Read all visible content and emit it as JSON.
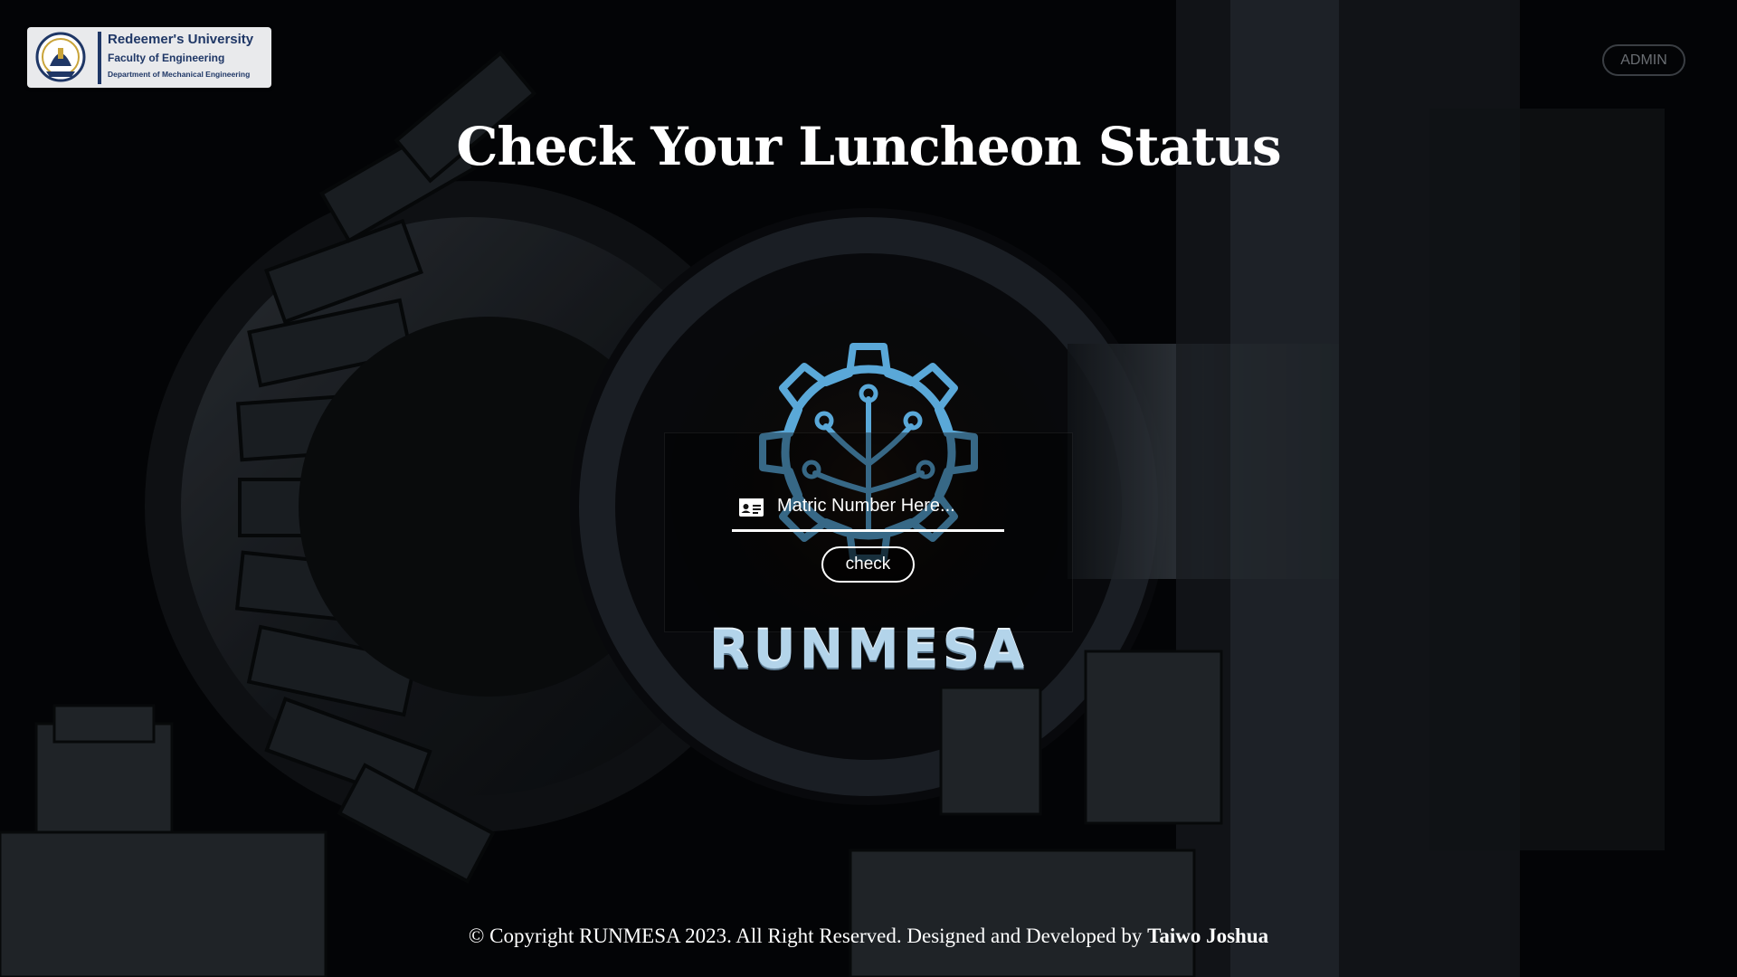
{
  "header": {
    "logo": {
      "university": "Redeemer's University",
      "faculty": "Faculty of Engineering",
      "department": "Department of Mechanical Engineering",
      "seal_icon": "university-seal-icon"
    },
    "admin_label": "ADMIN"
  },
  "main": {
    "title": "Check Your Luncheon Status",
    "form": {
      "input_icon": "id-card-icon",
      "matric_placeholder": "Matric Number Here...",
      "matric_value": "",
      "check_label": "check"
    },
    "brand_logo": {
      "icon": "gear-circuit-icon",
      "wordmark": "RUNMESA",
      "color": "#5aa8d8"
    }
  },
  "footer": {
    "copyright": "© Copyright RUNMESA 2023. All Right Reserved. Designed and Developed by ",
    "author": "Taiwo Joshua"
  },
  "colors": {
    "background": "#050608",
    "accent_blue": "#5aa8d8",
    "text": "#ffffff"
  }
}
